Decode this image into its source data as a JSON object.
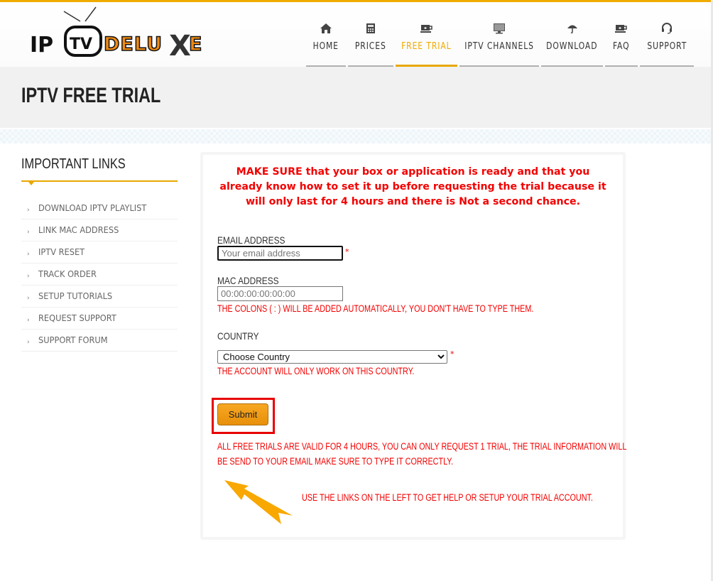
{
  "brand": {
    "name": "IPTV DELUXE",
    "logo_part1": "IP",
    "logo_part2": "TV",
    "logo_part3": "DELU",
    "logo_part4": "X",
    "logo_part5": "E",
    "accent_color": "#f0ab00"
  },
  "nav": {
    "items": [
      {
        "label": "HOME",
        "icon": "home-icon",
        "active": false
      },
      {
        "label": "PRICES",
        "icon": "calculator-icon",
        "active": false
      },
      {
        "label": "FREE TRIAL",
        "icon": "coffee-cup-icon",
        "active": true
      },
      {
        "label": "IPTV CHANNELS",
        "icon": "monitor-icon",
        "active": false
      },
      {
        "label": "DOWNLOAD",
        "icon": "umbrella-icon",
        "active": false
      },
      {
        "label": "FAQ",
        "icon": "coffee-cup-icon",
        "active": false
      },
      {
        "label": "SUPPORT",
        "icon": "headset-icon",
        "active": false
      }
    ]
  },
  "page": {
    "title": "IPTV FREE TRIAL"
  },
  "sidebar": {
    "title": "IMPORTANT LINKS",
    "links": [
      {
        "label": "DOWNLOAD IPTV PLAYLIST"
      },
      {
        "label": "LINK MAC ADDRESS"
      },
      {
        "label": "IPTV RESET"
      },
      {
        "label": "TRACK ORDER"
      },
      {
        "label": "SETUP TUTORIALS"
      },
      {
        "label": "REQUEST SUPPORT"
      },
      {
        "label": "SUPPORT FORUM"
      }
    ]
  },
  "main": {
    "notice": "MAKE SURE that your box or application is ready and that you already know how to set it up before requesting the trial because it will only last for 4 hours and there is Not a second chance.",
    "form": {
      "email": {
        "label": "EMAIL ADDRESS",
        "placeholder": "Your email address",
        "value": "",
        "required_mark": "*"
      },
      "mac": {
        "label": "MAC ADDRESS",
        "placeholder": "00:00:00:00:00:00",
        "value": "",
        "help": "THE COLONS ( : ) WILL BE ADDED AUTOMATICALLY, YOU DON'T HAVE TO TYPE THEM."
      },
      "country": {
        "label": "COUNTRY",
        "selected": "Choose Country",
        "required_mark": "*",
        "help": "THE ACCOUNT WILL ONLY WORK ON THIS COUNTRY."
      },
      "submit_label": "Submit"
    },
    "trial_note_line1": "ALL FREE TRIALS ARE VALID FOR 4 HOURS, YOU CAN ONLY REQUEST 1 TRIAL, THE TRIAL INFORMATION WILL",
    "trial_note_line2": "BE SEND TO YOUR EMAIL MAKE SURE TO TYPE IT CORRECTLY.",
    "links_hint": "USE THE LINKS ON THE LEFT TO GET HELP OR SETUP YOUR TRIAL ACCOUNT."
  }
}
